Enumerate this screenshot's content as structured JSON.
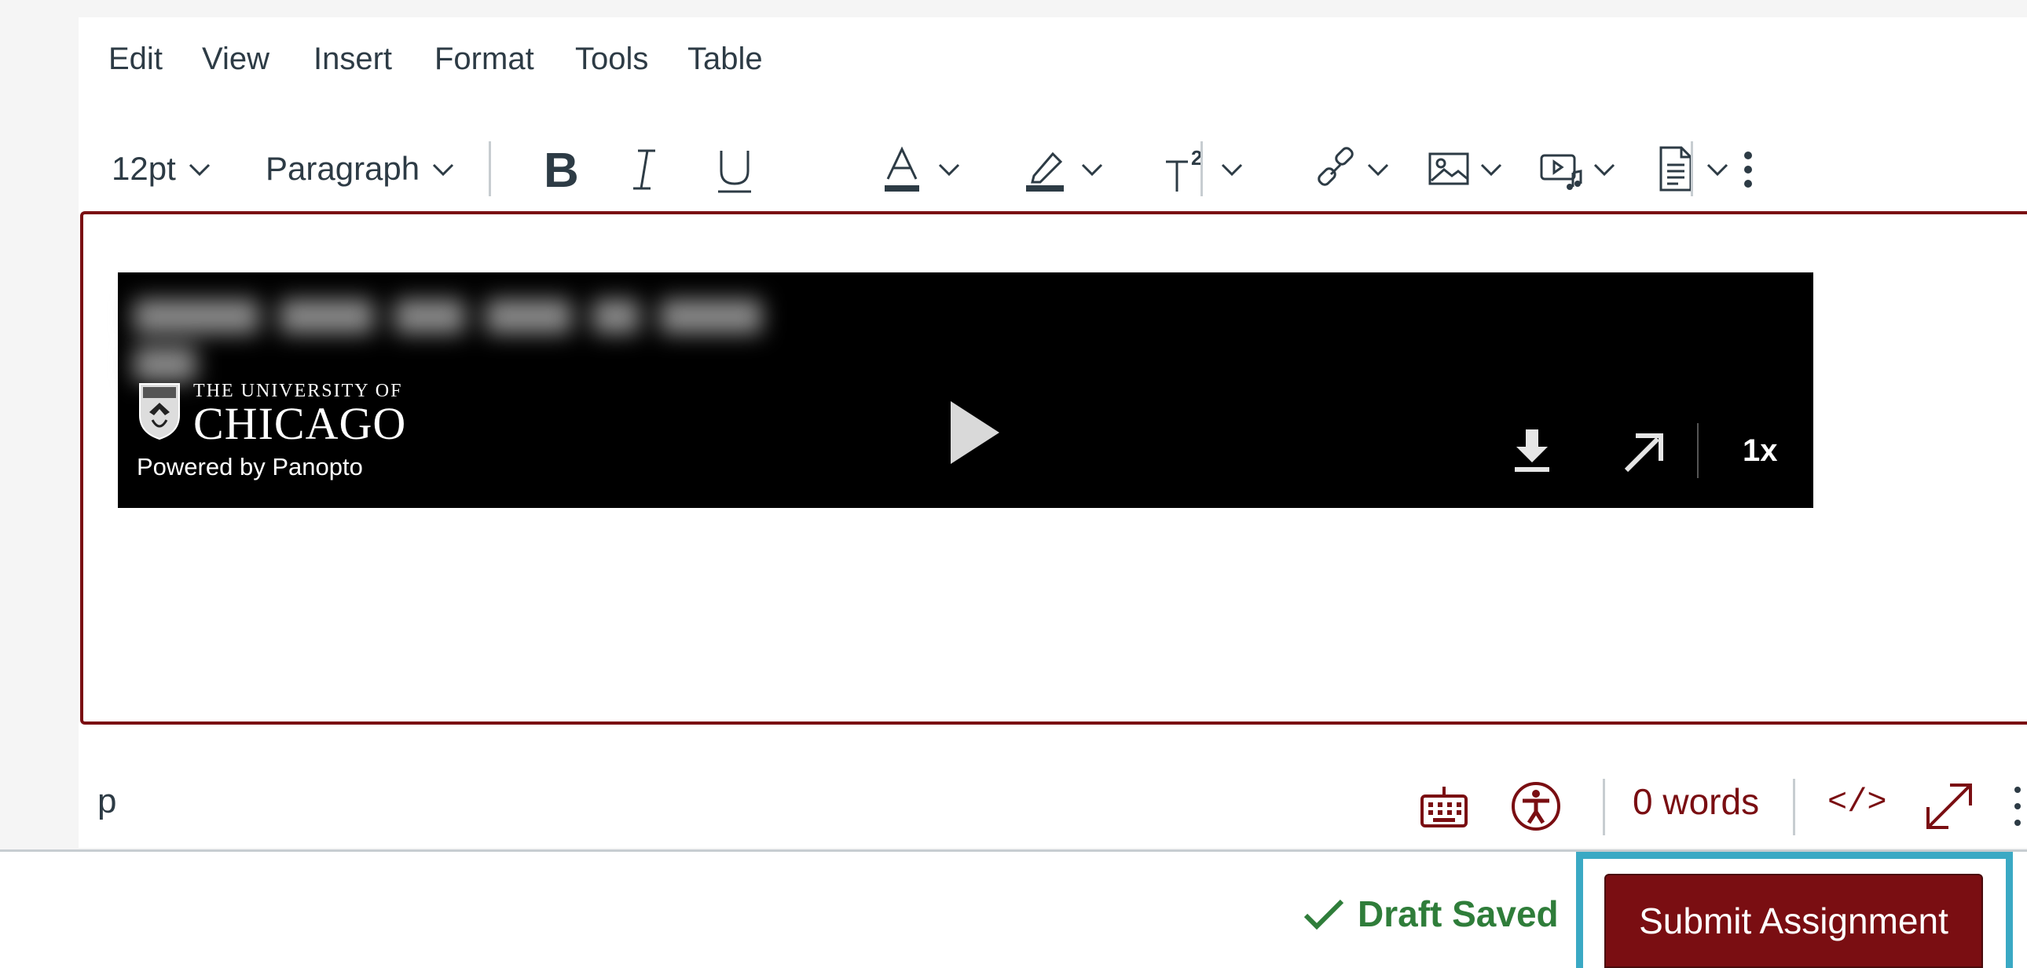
{
  "menubar": {
    "items": [
      "Edit",
      "View",
      "Insert",
      "Format",
      "Tools",
      "Table"
    ]
  },
  "toolbar": {
    "font_size": "12pt",
    "block_format": "Paragraph",
    "buttons": [
      "bold-icon",
      "italic-icon",
      "underline-icon",
      "text-color-icon",
      "highlight-icon",
      "superscript-icon",
      "link-icon",
      "image-icon",
      "media-icon",
      "document-icon",
      "more-vertical-icon"
    ]
  },
  "video": {
    "logo_line1": "THE UNIVERSITY OF",
    "logo_line2": "CHICAGO",
    "powered_by": "Powered by Panopto",
    "speed": "1x"
  },
  "statusbar": {
    "path": "p",
    "word_count": "0 words",
    "html_toggle": "</>"
  },
  "footer": {
    "draft_status": "Draft Saved",
    "submit_label": "Submit Assignment"
  },
  "colors": {
    "accent": "#7a0e12",
    "success": "#2f7d3a",
    "highlight": "#3aa9c4"
  }
}
